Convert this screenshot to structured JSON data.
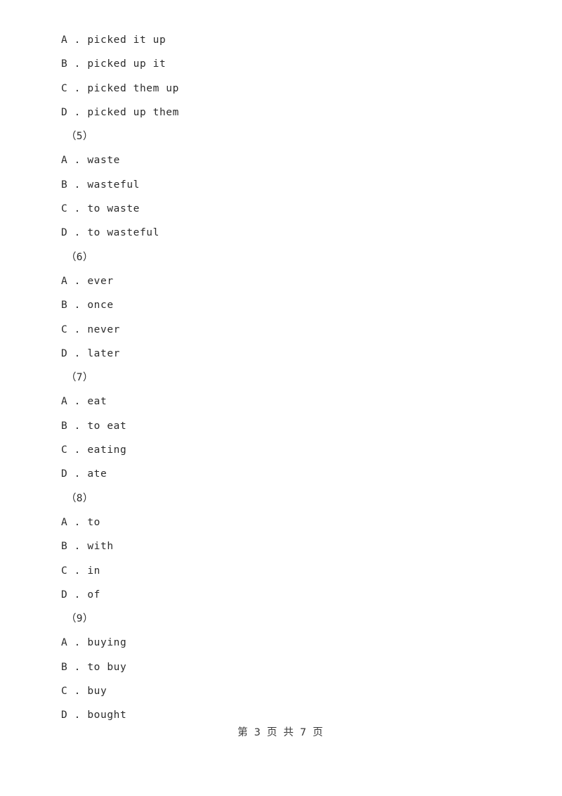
{
  "page": {
    "background_color": "#ffffff",
    "text_color": "#2b2b2b",
    "footer_color": "#3a3a3a"
  },
  "document": {
    "lines": [
      {
        "kind": "option",
        "letter": "A",
        "separator": " . ",
        "text": "picked it up"
      },
      {
        "kind": "option",
        "letter": "B",
        "separator": " . ",
        "text": "picked up it"
      },
      {
        "kind": "option",
        "letter": "C",
        "separator": " . ",
        "text": "picked them up"
      },
      {
        "kind": "option",
        "letter": "D",
        "separator": " . ",
        "text": "picked up them"
      },
      {
        "kind": "qnum",
        "text": "（5）"
      },
      {
        "kind": "option",
        "letter": "A",
        "separator": " . ",
        "text": "waste"
      },
      {
        "kind": "option",
        "letter": "B",
        "separator": " . ",
        "text": "wasteful"
      },
      {
        "kind": "option",
        "letter": "C",
        "separator": " . ",
        "text": "to waste"
      },
      {
        "kind": "option",
        "letter": "D",
        "separator": " . ",
        "text": "to wasteful"
      },
      {
        "kind": "qnum",
        "text": "（6）"
      },
      {
        "kind": "option",
        "letter": "A",
        "separator": " . ",
        "text": "ever"
      },
      {
        "kind": "option",
        "letter": "B",
        "separator": " . ",
        "text": "once"
      },
      {
        "kind": "option",
        "letter": "C",
        "separator": " . ",
        "text": "never"
      },
      {
        "kind": "option",
        "letter": "D",
        "separator": " . ",
        "text": "later"
      },
      {
        "kind": "qnum",
        "text": "（7）"
      },
      {
        "kind": "option",
        "letter": "A",
        "separator": " . ",
        "text": "eat"
      },
      {
        "kind": "option",
        "letter": "B",
        "separator": " . ",
        "text": "to eat"
      },
      {
        "kind": "option",
        "letter": "C",
        "separator": " . ",
        "text": "eating"
      },
      {
        "kind": "option",
        "letter": "D",
        "separator": " . ",
        "text": "ate"
      },
      {
        "kind": "qnum",
        "text": "（8）"
      },
      {
        "kind": "option",
        "letter": "A",
        "separator": " . ",
        "text": "to"
      },
      {
        "kind": "option",
        "letter": "B",
        "separator": " . ",
        "text": "with"
      },
      {
        "kind": "option",
        "letter": "C",
        "separator": " . ",
        "text": "in"
      },
      {
        "kind": "option",
        "letter": "D",
        "separator": " . ",
        "text": "of"
      },
      {
        "kind": "qnum",
        "text": "（9）"
      },
      {
        "kind": "option",
        "letter": "A",
        "separator": " . ",
        "text": "buying"
      },
      {
        "kind": "option",
        "letter": "B",
        "separator": " . ",
        "text": "to buy"
      },
      {
        "kind": "option",
        "letter": "C",
        "separator": " . ",
        "text": "buy"
      },
      {
        "kind": "option",
        "letter": "D",
        "separator": " . ",
        "text": "bought"
      }
    ]
  },
  "footer": {
    "text": "第 3 页 共 7 页",
    "current_page": "3",
    "total_pages": "7"
  }
}
